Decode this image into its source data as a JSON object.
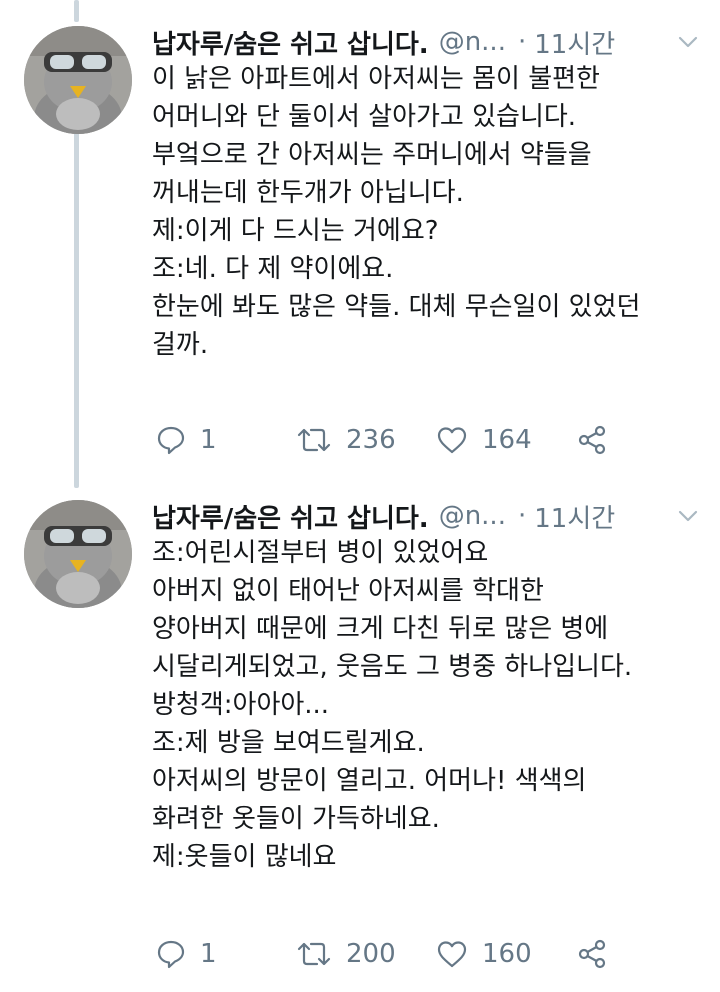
{
  "tweets": [
    {
      "name": "납자루/숨은 쉬고 삽니다.",
      "handle": "@n...",
      "time": "11시간",
      "lines": [
        "이 낡은 아파트에서 아저씨는 몸이 불편한",
        "어머니와 단 둘이서 살아가고 있습니다.",
        "부엌으로 간 아저씨는 주머니에서 약들을",
        "꺼내는데 한두개가 아닙니다.",
        "제:이게 다 드시는 거에요?",
        "조:네. 다 제 약이에요.",
        "한눈에 봐도 많은 약들. 대체 무슨일이 있었던",
        "걸까."
      ],
      "replies": "1",
      "retweets": "236",
      "likes": "164"
    },
    {
      "name": "납자루/숨은 쉬고 삽니다.",
      "handle": "@n...",
      "time": "11시간",
      "lines": [
        "조:어린시절부터 병이 있었어요",
        "아버지 없이 태어난 아저씨를 학대한",
        "양아버지 때문에 크게 다친 뒤로 많은 병에",
        "시달리게되었고, 웃음도 그 병중 하나입니다.",
        "방청객:아아아...",
        "조:제 방을 보여드릴게요.",
        "아저씨의 방문이 열리고. 어머나! 색색의",
        "화려한 옷들이 가득하네요.",
        "제:옷들이 많네요"
      ],
      "replies": "1",
      "retweets": "200",
      "likes": "160"
    }
  ],
  "colors": {
    "text": "#14171a",
    "secondary": "#657786",
    "thread_line": "#ccd6dd"
  },
  "icons": [
    "reply-icon",
    "retweet-icon",
    "like-icon",
    "share-icon",
    "chevron-down-icon"
  ]
}
